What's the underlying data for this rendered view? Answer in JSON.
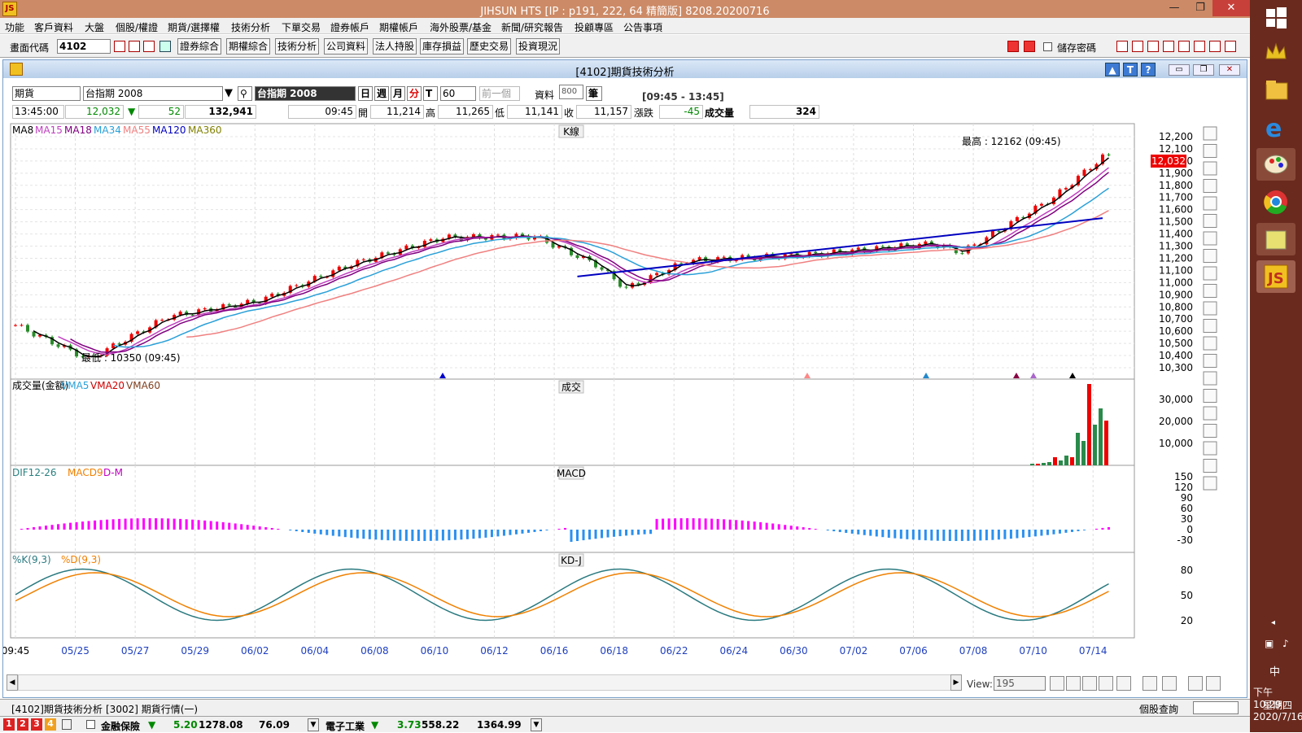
{
  "app": {
    "title": "JIHSUN HTS      [IP : p191, 222, 64 精簡版] 8208.20200716"
  },
  "menu": [
    "功能",
    "客戶資料",
    "大盤",
    "個股/權證",
    "期貨/選擇權",
    "技術分析",
    "下單交易",
    "證券帳戶",
    "期權帳戶",
    "海外股票/基金",
    "新聞/研究報告",
    "投顧專區",
    "公告事項"
  ],
  "toolbar": {
    "code_label": "畫面代碼",
    "code_value": "4102",
    "buttons": [
      "證券綜合",
      "期權綜合",
      "技術分析",
      "公司資料",
      "法人持股",
      "庫存損益",
      "歷史交易",
      "投資現況"
    ],
    "save_pw": "儲存密碼"
  },
  "window": {
    "title": "[4102]期貨技術分析"
  },
  "controls": {
    "market": "期貨",
    "product": "台指期 2008",
    "product_display": "台指期 2008",
    "period_day": "日",
    "period_week": "週",
    "period_month": "月",
    "period_min": "分",
    "period_tick": "T",
    "interval": "60",
    "prev": "前一個",
    "data_label": "資料",
    "data_count": "800",
    "unit": "筆",
    "time_range": "[09:45 - 13:45]"
  },
  "quote": {
    "time": "13:45:00",
    "price": "12,032",
    "arrow": "▼",
    "change": "52",
    "volume_total": "132,941",
    "bar_time": "09:45",
    "open_label": "開",
    "open": "11,214",
    "high_label": "高",
    "high": "11,265",
    "low_label": "低",
    "low": "11,141",
    "close_label": "收",
    "close": "11,157",
    "chg_label": "漲跌",
    "chg": "-45",
    "vol_label": "成交量",
    "vol": "324"
  },
  "panels": {
    "k_title": "K線",
    "vol_title": "成交",
    "macd_title": "MACD",
    "kd_title": "KD-J"
  },
  "legends": {
    "ma": [
      {
        "name": "MA8",
        "color": "#000000"
      },
      {
        "name": "MA15",
        "color": "#c040c0"
      },
      {
        "name": "MA18",
        "color": "#800080"
      },
      {
        "name": "MA34",
        "color": "#2aa0d8"
      },
      {
        "name": "MA55",
        "color": "#f08080"
      },
      {
        "name": "MA120",
        "color": "#0000c0"
      },
      {
        "name": "MA360",
        "color": "#808000"
      }
    ],
    "vol": [
      {
        "name": "成交量(金額)",
        "color": "#000000"
      },
      {
        "name": "VMA5",
        "color": "#2aa0d8"
      },
      {
        "name": "VMA20",
        "color": "#d00000"
      },
      {
        "name": "VMA60",
        "color": "#804020"
      }
    ],
    "macd": [
      {
        "name": "DIF12-26",
        "color": "#2a8080"
      },
      {
        "name": "MACD9",
        "color": "#f08000"
      },
      {
        "name": "D-M",
        "color": "#c000c0"
      }
    ],
    "kd": [
      {
        "name": "%K(9,3)",
        "color": "#2a7a80"
      },
      {
        "name": "%D(9,3)",
        "color": "#f08000"
      }
    ]
  },
  "annotations": {
    "high": "最高 : 12162 (09:45)",
    "low": "最低 : 10350 (09:45)",
    "last_price": "12,032"
  },
  "axes": {
    "price_ticks": [
      "12,200",
      "12,100",
      "12,000",
      "11,900",
      "11,800",
      "11,700",
      "11,600",
      "11,500",
      "11,400",
      "11,300",
      "11,200",
      "11,100",
      "11,000",
      "10,900",
      "10,800",
      "10,700",
      "10,600",
      "10,500",
      "10,400",
      "10,300"
    ],
    "vol_ticks": [
      "30,000",
      "20,000",
      "10,000"
    ],
    "macd_ticks": [
      "150",
      "120",
      "90",
      "60",
      "30",
      "0",
      "-30"
    ],
    "kd_ticks": [
      "80",
      "50",
      "20"
    ],
    "dates": [
      "09:45",
      "05/25",
      "05/27",
      "05/29",
      "06/02",
      "06/04",
      "06/08",
      "06/10",
      "06/12",
      "06/16",
      "06/18",
      "06/22",
      "06/24",
      "06/30",
      "07/02",
      "07/06",
      "07/08",
      "07/10",
      "07/14"
    ]
  },
  "view": {
    "label": "View:",
    "value": "195"
  },
  "tabs": [
    "[4102]期貨技術分析",
    "[3002] 期貨行情(一)"
  ],
  "status": {
    "stock_query": "個股查詢",
    "nums": [
      "1",
      "2",
      "3",
      "4"
    ],
    "sector1": "金融保險",
    "s1_arrow": "▼",
    "s1_a": "5.20",
    "s1_b": "1278.08",
    "s1_c": "76.09",
    "sector2": "電子工業",
    "s2_arrow": "▼",
    "s2_a": "3.73",
    "s2_b": "558.22",
    "s2_c": "1364.99"
  },
  "clock": {
    "ime": "中",
    "time": "下午 10:29",
    "weekday": "星期四",
    "date": "2020/7/16"
  },
  "chart_data": {
    "type": "candlestick",
    "ylim": [
      10300,
      12200
    ],
    "series_summary": [
      {
        "name": "high",
        "value": 12162
      },
      {
        "name": "low",
        "value": 10350
      }
    ],
    "last": 12032
  }
}
